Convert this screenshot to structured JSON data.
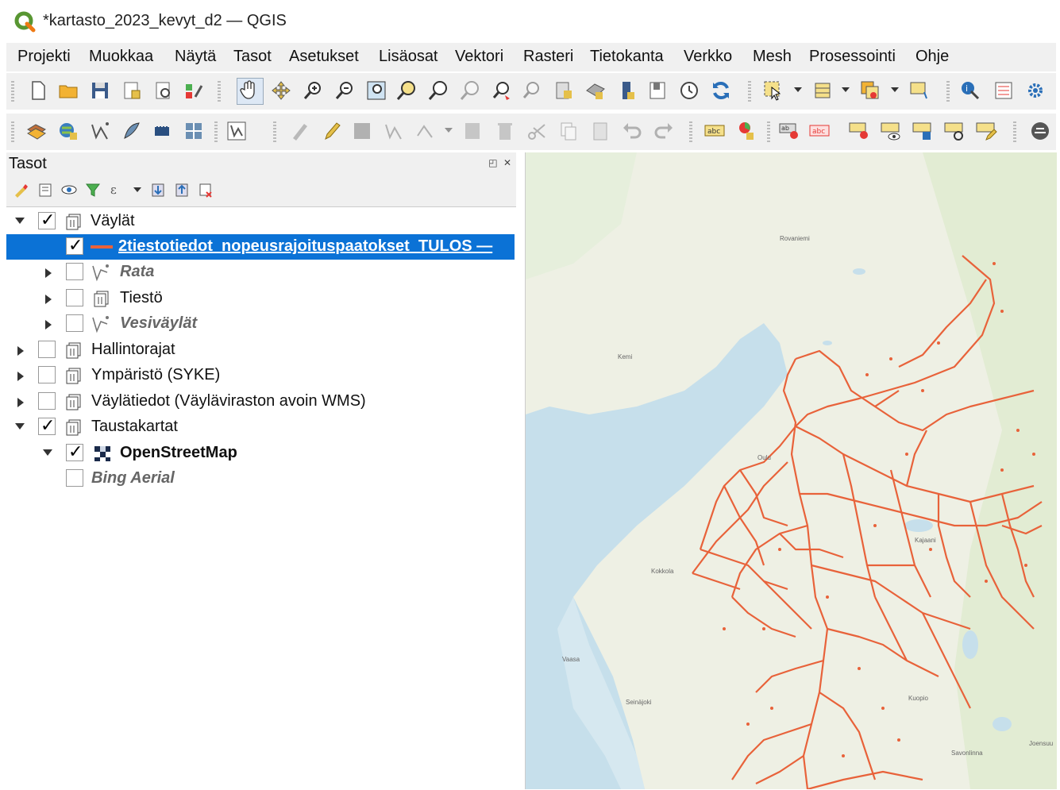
{
  "window": {
    "title": "*kartasto_2023_kevyt_d2 — QGIS"
  },
  "menu": {
    "items": [
      "Projekti",
      "Muokkaa",
      "Näytä",
      "Tasot",
      "Asetukset",
      "Lisäosat",
      "Vektori",
      "Rasteri",
      "Tietokanta",
      "Verkko",
      "Mesh",
      "Prosessointi",
      "Ohje"
    ]
  },
  "toolbar1": {
    "icons": [
      "new-project-icon",
      "open-project-icon",
      "save-project-icon",
      "print-layout-icon",
      "layout-manager-icon",
      "style-manager-icon",
      "pan-icon",
      "pan-to-selection-icon",
      "zoom-in-icon",
      "zoom-out-icon",
      "zoom-full-icon",
      "zoom-to-selection-icon",
      "zoom-to-layer-icon",
      "zoom-native-icon",
      "zoom-last-icon",
      "zoom-next-icon",
      "new-bookmark-icon",
      "show-bookmarks-icon",
      "temporal-controller-icon",
      "refresh-icon",
      "select-features-icon",
      "attribute-table-icon",
      "field-calculator-icon",
      "statistics-icon",
      "identify-icon",
      "measure-icon",
      "settings-icon"
    ]
  },
  "toolbar2": {
    "icons": [
      "data-source-manager-icon",
      "add-wms-icon",
      "add-vector-icon",
      "add-spatialite-icon",
      "add-postgis-icon",
      "add-raster-icon",
      "new-shapefile-icon",
      "digitize-icon",
      "edit-pencil-icon",
      "save-edits-icon",
      "add-feature-icon",
      "vertex-tool-icon",
      "delete-icon",
      "cut-icon",
      "copy-icon",
      "paste-icon",
      "undo-icon",
      "redo-icon",
      "label-icon",
      "diagram-icon",
      "pin-label-icon",
      "highlight-label-icon",
      "move-label-icon",
      "show-label-icon",
      "rotate-label-icon",
      "change-label-icon",
      "label-edit-icon",
      "map-tips-icon"
    ],
    "label_tag": "abc"
  },
  "layers_panel": {
    "title": "Tasot",
    "window_buttons": "◰ ✕",
    "tools": [
      "style-icon",
      "add-group-icon",
      "visibility-icon",
      "filter-icon",
      "expression-icon",
      "expand-icon",
      "collapse-icon",
      "remove-icon"
    ],
    "tree": [
      {
        "label": "Väylät",
        "checked": true,
        "expanded": true,
        "depth": 0,
        "kind": "group"
      },
      {
        "label": "2tiestotiedot_nopeusrajoituspaatokset_TULOS —",
        "checked": true,
        "depth": 1,
        "kind": "line",
        "selected": true
      },
      {
        "label": "Rata",
        "checked": false,
        "depth": 1,
        "kind": "vector",
        "style": "ital",
        "has_arrow": true
      },
      {
        "label": "Tiestö",
        "checked": false,
        "depth": 1,
        "kind": "group",
        "has_arrow": true
      },
      {
        "label": "Vesiväylät",
        "checked": false,
        "depth": 1,
        "kind": "vector",
        "style": "ital",
        "has_arrow": true
      },
      {
        "label": "Hallintorajat",
        "checked": false,
        "depth": 0,
        "kind": "group",
        "has_arrow": true
      },
      {
        "label": "Ympäristö (SYKE)",
        "checked": false,
        "depth": 0,
        "kind": "group",
        "has_arrow": true
      },
      {
        "label": "Väylätiedot (Väyläviraston avoin WMS)",
        "checked": false,
        "depth": 0,
        "kind": "group",
        "has_arrow": true
      },
      {
        "label": "Taustakartat",
        "checked": true,
        "expanded": true,
        "depth": 0,
        "kind": "group"
      },
      {
        "label": "OpenStreetMap",
        "checked": true,
        "expanded": true,
        "depth": 1,
        "kind": "raster",
        "style": "bold"
      },
      {
        "label": "Bing Aerial",
        "checked": false,
        "depth": 1,
        "kind": "none",
        "style": "ital"
      }
    ]
  },
  "map": {
    "road_color": "#e8623a",
    "sea_color": "#c6dfeb",
    "land_color": "#eef0e4",
    "places": [
      "Rovaniemi",
      "Kemi",
      "Oulu",
      "Kokkola",
      "Vaasa",
      "Seinäjoki",
      "Kuopio",
      "Savonlinna",
      "Joensuu",
      "Kajaani"
    ]
  },
  "colors": {
    "selection": "#0b72d6",
    "toolbar_bg": "#f0f0f0",
    "qgis_green": "#589632"
  }
}
